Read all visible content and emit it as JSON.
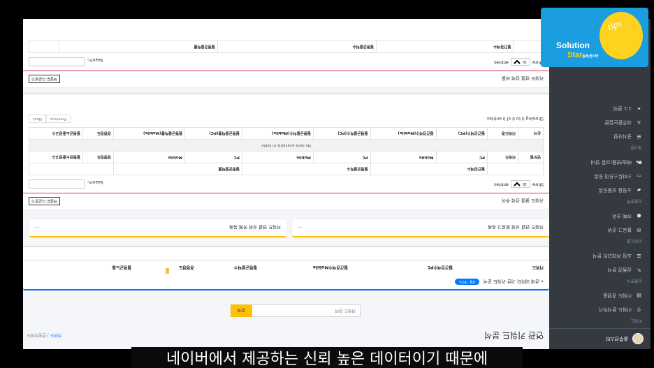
{
  "colors": {
    "sidebar": "#343a40",
    "accent_yellow": "#ffc107",
    "section_line": "#d8336f",
    "primary": "#007bff"
  },
  "sidebar": {
    "user": "솔루션스타",
    "header_1": "키워드",
    "items_1": [
      {
        "icon": "search-icon",
        "label": "키워드 분석하기"
      },
      {
        "icon": "chart-icon",
        "label": "키워드 경쟁율"
      }
    ],
    "header_2": "상품분석",
    "items_2": [
      {
        "icon": "pencil-icon",
        "label": "상품명 분석"
      },
      {
        "icon": "list-icon",
        "label": "쇼핑 카테고리 분석"
      }
    ],
    "header_3": "상위노출",
    "items_3": [
      {
        "icon": "chat-icon",
        "label": "블로그 순위"
      },
      {
        "icon": "info-icon",
        "label": "카페 순위"
      }
    ],
    "header_4": "상품등록",
    "items_4": [
      {
        "icon": "car-icon",
        "label": "쇼핑몰 상품등록"
      },
      {
        "icon": "monitor-icon",
        "label": "스마트스토어 등록"
      },
      {
        "icon": "truck-icon",
        "label": "배송/반품/교환 안내"
      }
    ],
    "header_5": "게시판",
    "items_5": [
      {
        "icon": "list-icon",
        "label": "공지사항"
      },
      {
        "icon": "user-icon",
        "label": "자주묻는질문"
      },
      {
        "icon": "pin-icon",
        "label": "1:1 문의"
      }
    ]
  },
  "header": {
    "title": "연관 키워드 분석",
    "breadcrumb_home": "키워드",
    "breadcrumb_sep": " / ",
    "breadcrumb_current": "연관키워드"
  },
  "search": {
    "placeholder": "키워드 입력",
    "button": "검색"
  },
  "keyword_card": {
    "title": "« 검색 데이터 기반 키워드 분석",
    "badge": "사용 가이드",
    "columns": [
      "키워드",
      "월간검색수PC",
      "월간검색수Mobile",
      "월평균클릭수",
      "경쟁정도",
      "월평균노출"
    ]
  },
  "mini_cards": [
    {
      "label": "키워드 연관 상위 블로그 목록",
      "dash": "—"
    },
    {
      "label": "키워드 연관 상위 카페 목록",
      "dash": "—"
    }
  ],
  "sections": [
    {
      "title": "키워드 월별 검색 추이",
      "button": "엑셀로 다운받기",
      "show": "Show",
      "entries_value": "10",
      "entries": "entries",
      "search_label": "Search:",
      "group_headers": [
        "월간검색수",
        "월평균클릭수",
        "월평균클릭률"
      ],
      "sub_headers": [
        "연도별",
        "키워드",
        "PC",
        "Mobile",
        "PC",
        "Mobile",
        "PC",
        "Mobile",
        "경쟁정도",
        "월평균노출광고수"
      ],
      "header_row2": [
        "순서",
        "키워드명",
        "월간검색수(PC)",
        "월간검색수(Mobile)",
        "월평균클릭수(PC)",
        "월평균클릭수(Mobile)",
        "월평균클릭률(PC)",
        "월평균클릭률(Mobile)",
        "경쟁정도",
        "월평균노출광고수"
      ],
      "empty": "No data available in table",
      "info": "Showing 0 to 0 of 0 entries",
      "prev": "Previous",
      "next": "Next"
    },
    {
      "title": "키워드 성별 검색 비율",
      "button": "엑셀로 다운받기",
      "show": "Show",
      "entries_value": "10",
      "entries": "entries",
      "search_label": "Search:",
      "group_headers": [
        "월간검색수",
        "월평균클릭수",
        "월평균클릭률"
      ]
    }
  ],
  "subtitle": "네이버에서 제공하는 신뢰 높은 데이터이기 때문에",
  "logo": {
    "text1": "Solution",
    "text2": "Star",
    "text2_small": "솔루션스타",
    "tag": "tips"
  }
}
